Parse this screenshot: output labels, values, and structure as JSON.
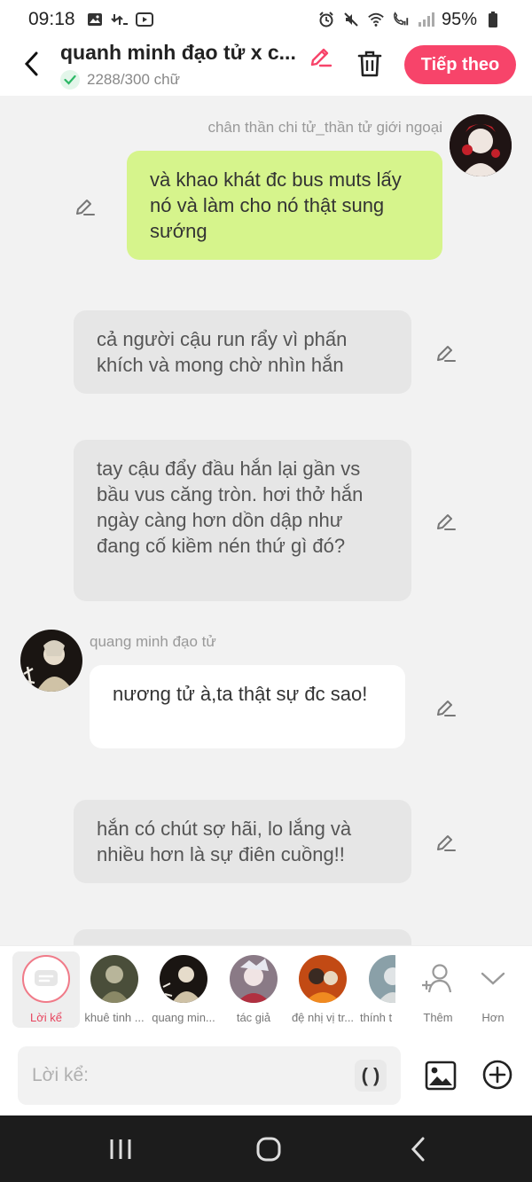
{
  "status_bar": {
    "time": "09:18",
    "battery": "95%"
  },
  "header": {
    "title": "quanh minh đạo tử x c...",
    "word_count": "2288/300 chữ",
    "next_label": "Tiếp theo"
  },
  "messages": [
    {
      "sender": "chân thần chi tử_thần tử giới ngoại",
      "text": "và khao khát đc bus muts lấy nó và làm cho nó thật sung sướng"
    },
    {
      "text": "cả người cậu run rẩy vì phấn khích và mong chờ nhìn hắn"
    },
    {
      "text": "tay cậu đẩy đầu hắn lại gần vs bầu vus căng tròn. hơi thở hắn ngày càng hơn dồn dập như đang cố kiềm nén thứ gì đó?"
    },
    {
      "sender": "quang minh đạo tử",
      "text": "nương tử à,ta thật sự đc sao!"
    },
    {
      "text": "hắn có chút sợ hãi, lo lắng và nhiều hơn là sự điên cuồng!!"
    }
  ],
  "cast": [
    {
      "label": "Lời kể"
    },
    {
      "label": "khuê tinh ..."
    },
    {
      "label": "quang min..."
    },
    {
      "label": "tác giả"
    },
    {
      "label": "đệ nhị vị tr..."
    },
    {
      "label": "thính t"
    },
    {
      "label": "Thêm"
    },
    {
      "label": "Hơn"
    }
  ],
  "input": {
    "placeholder": "Lời kể:",
    "paren_label": "( )"
  },
  "colors": {
    "accent": "#f7446a",
    "user_bubble": "#d6f48c",
    "narration_bubble": "#e6e6e6"
  }
}
